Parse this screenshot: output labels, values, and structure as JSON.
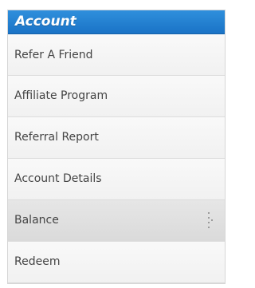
{
  "panel": {
    "title": "Account",
    "items": [
      {
        "label": "Refer A Friend"
      },
      {
        "label": "Affiliate Program"
      },
      {
        "label": "Referral Report"
      },
      {
        "label": "Account Details"
      },
      {
        "label": "Balance",
        "active": true,
        "icon": "grip-dots-icon"
      },
      {
        "label": "Redeem"
      }
    ]
  },
  "colors": {
    "header_accent": "#1a73c6",
    "active_row": "#dadada"
  }
}
